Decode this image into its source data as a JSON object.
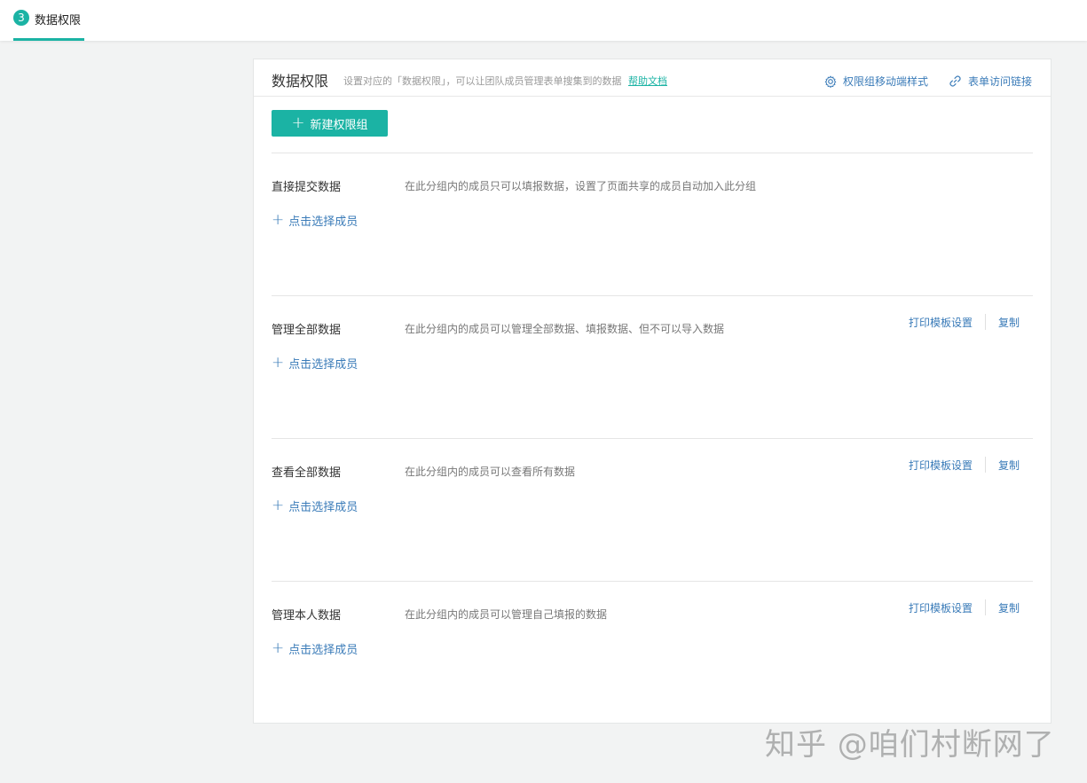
{
  "step": {
    "number": "3",
    "label": "数据权限"
  },
  "header": {
    "title": "数据权限",
    "description": "设置对应的「数据权限」，可以让团队成员管理表单搜集到的数据",
    "help_link": "帮助文档",
    "mobile_style": "权限组移动端样式",
    "access_link": "表单访问链接"
  },
  "new_group_button": "新建权限组",
  "groups": [
    {
      "name": "直接提交数据",
      "description": "在此分组内的成员只可以填报数据，设置了页面共享的成员自动加入此分组",
      "add_member": "点击选择成员"
    },
    {
      "name": "管理全部数据",
      "description": "在此分组内的成员可以管理全部数据、填报数据、但不可以导入数据",
      "add_member": "点击选择成员",
      "print_template": "打印模板设置",
      "copy": "复制"
    },
    {
      "name": "查看全部数据",
      "description": "在此分组内的成员可以查看所有数据",
      "add_member": "点击选择成员",
      "print_template": "打印模板设置",
      "copy": "复制"
    },
    {
      "name": "管理本人数据",
      "description": "在此分组内的成员可以管理自己填报的数据",
      "add_member": "点击选择成员",
      "print_template": "打印模板设置",
      "copy": "复制"
    }
  ],
  "watermark": "知乎 @咱们村断网了",
  "colors": {
    "accent": "#1bb3a4",
    "link": "#3a7bb8"
  }
}
